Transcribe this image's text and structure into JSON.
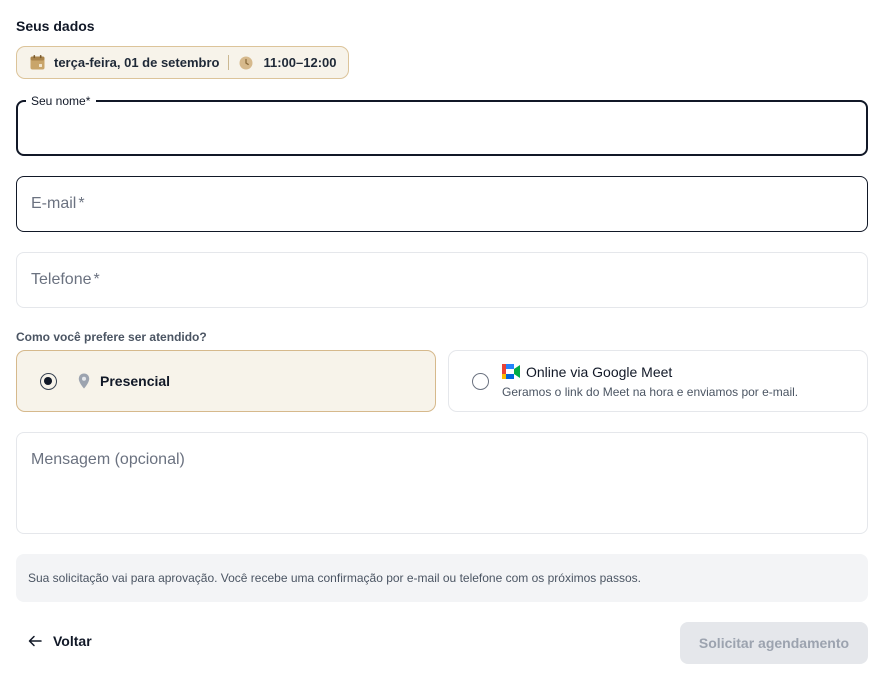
{
  "section_title": "Seus dados",
  "booking": {
    "date": "terça-feira, 01 de setembro",
    "time": "11:00–12:00"
  },
  "fields": {
    "name": {
      "label": "Seu nome",
      "required_mark": "*",
      "value": ""
    },
    "email": {
      "label": "E-mail",
      "required_mark": "*",
      "value": ""
    },
    "phone": {
      "label": "Telefone",
      "required_mark": "*",
      "value": ""
    },
    "message": {
      "label": "Mensagem (opcional)",
      "value": ""
    }
  },
  "attendance": {
    "question": "Como você prefere ser atendido?",
    "options": [
      {
        "label": "Presencial",
        "selected": true,
        "icon": "location-pin-icon"
      },
      {
        "label": "Online via Google Meet",
        "description": "Geramos o link do Meet na hora e enviamos por e-mail.",
        "selected": false,
        "icon": "google-meet-icon"
      }
    ]
  },
  "note": "Sua solicitação vai para aprovação. Você recebe uma confirmação por e-mail ou telefone com os próximos passos.",
  "actions": {
    "back_label": "Voltar",
    "submit_label": "Solicitar agendamento"
  },
  "colors": {
    "accent_bg": "#f7f3ea",
    "accent_border": "#d6b98c",
    "disabled_bg": "#e5e7eb",
    "disabled_text": "#9ca3af"
  }
}
